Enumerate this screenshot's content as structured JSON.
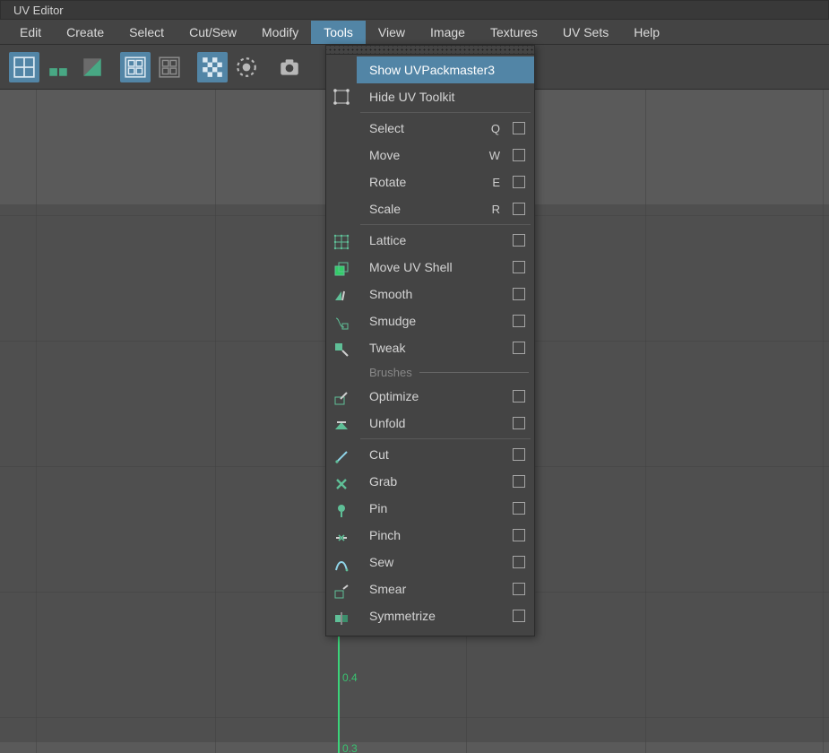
{
  "window": {
    "title": "UV Editor"
  },
  "menubar": {
    "items": [
      "Edit",
      "Create",
      "Select",
      "Cut/Sew",
      "Modify",
      "Tools",
      "View",
      "Image",
      "Textures",
      "UV Sets",
      "Help"
    ],
    "active_index": 5
  },
  "toolbar": {
    "buttons": [
      {
        "name": "uv-grid-1",
        "active": true
      },
      {
        "name": "uv-grid-2",
        "active": false
      },
      {
        "name": "uv-grid-3",
        "active": false
      },
      {
        "name": "uv-tile-toggle",
        "active": true
      },
      {
        "name": "uv-tile-off",
        "active": false
      },
      {
        "name": "uv-checker",
        "active": true
      },
      {
        "name": "isolate-select",
        "active": false
      },
      {
        "name": "snapshot",
        "active": false
      }
    ]
  },
  "axis": {
    "label_0_4": "0.4",
    "label_0_3": "0.3"
  },
  "dropdown": {
    "sections": {
      "top": [
        {
          "label": "Show UVPackmaster3",
          "highlight": true,
          "opt": false,
          "icon": null
        },
        {
          "label": "Hide UV Toolkit",
          "opt": false,
          "icon": "lattice-small"
        }
      ],
      "transform": [
        {
          "label": "Select",
          "shortcut": "Q",
          "opt": true
        },
        {
          "label": "Move",
          "shortcut": "W",
          "opt": true
        },
        {
          "label": "Rotate",
          "shortcut": "E",
          "opt": true
        },
        {
          "label": "Scale",
          "shortcut": "R",
          "opt": true
        }
      ],
      "deform": [
        {
          "label": "Lattice",
          "opt": true,
          "icon": "lattice"
        },
        {
          "label": "Move UV Shell",
          "opt": true,
          "icon": "move-shell"
        },
        {
          "label": "Smooth",
          "opt": true,
          "icon": "smooth"
        },
        {
          "label": "Smudge",
          "opt": true,
          "icon": "smudge"
        },
        {
          "label": "Tweak",
          "opt": true,
          "icon": "tweak"
        }
      ],
      "brushes_header": "Brushes",
      "brushes": [
        {
          "label": "Optimize",
          "opt": true,
          "icon": "optimize"
        },
        {
          "label": "Unfold",
          "opt": true,
          "icon": "unfold"
        }
      ],
      "cuts": [
        {
          "label": "Cut",
          "opt": true,
          "icon": "cut"
        },
        {
          "label": "Grab",
          "opt": true,
          "icon": "grab"
        },
        {
          "label": "Pin",
          "opt": true,
          "icon": "pin"
        },
        {
          "label": "Pinch",
          "opt": true,
          "icon": "pinch"
        },
        {
          "label": "Sew",
          "opt": true,
          "icon": "sew"
        },
        {
          "label": "Smear",
          "opt": true,
          "icon": "smear"
        },
        {
          "label": "Symmetrize",
          "opt": true,
          "icon": "symmetrize"
        }
      ]
    }
  }
}
